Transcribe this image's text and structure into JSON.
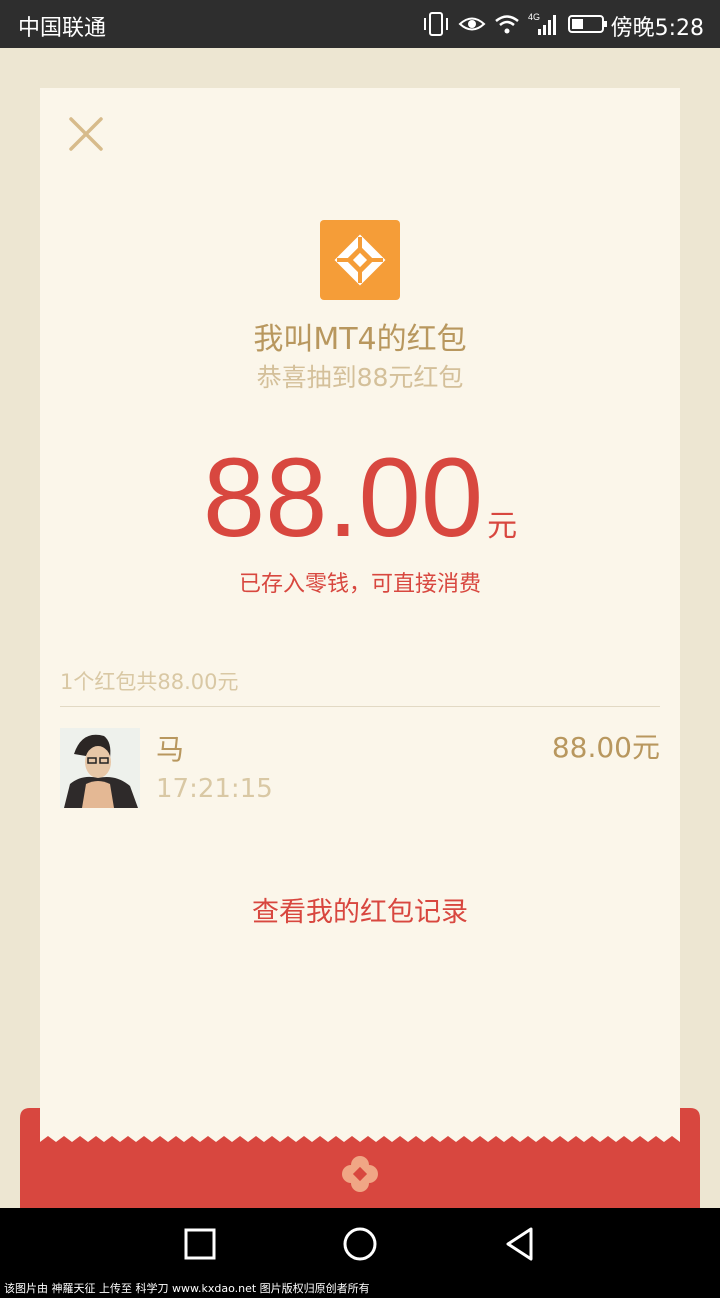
{
  "status_bar": {
    "carrier": "中国联通",
    "network_type": "4G",
    "time": "傍晚5:28"
  },
  "red_packet": {
    "sender_line": "我叫MT4的红包",
    "wish": "恭喜抽到88元红包",
    "amount": "88.00",
    "unit": "元",
    "note": "已存入零钱，可直接消费",
    "summary": "1个红包共88.00元",
    "records_link": "查看我的红包记录"
  },
  "receivers": [
    {
      "name": "马",
      "time": "17:21:15",
      "amount": "88.00元"
    }
  ],
  "watermark": "该图片由 神羅天征 上传至 科学刀 www.kxdao.net 图片版权归原创者所有",
  "colors": {
    "accent_red": "#d8473f",
    "gold": "#b8975e",
    "logo_orange": "#f59d38",
    "card_bg": "#fbf6ea"
  },
  "icons": [
    "close-icon",
    "packet-logo-icon",
    "recent-apps-icon",
    "home-icon",
    "back-icon"
  ]
}
